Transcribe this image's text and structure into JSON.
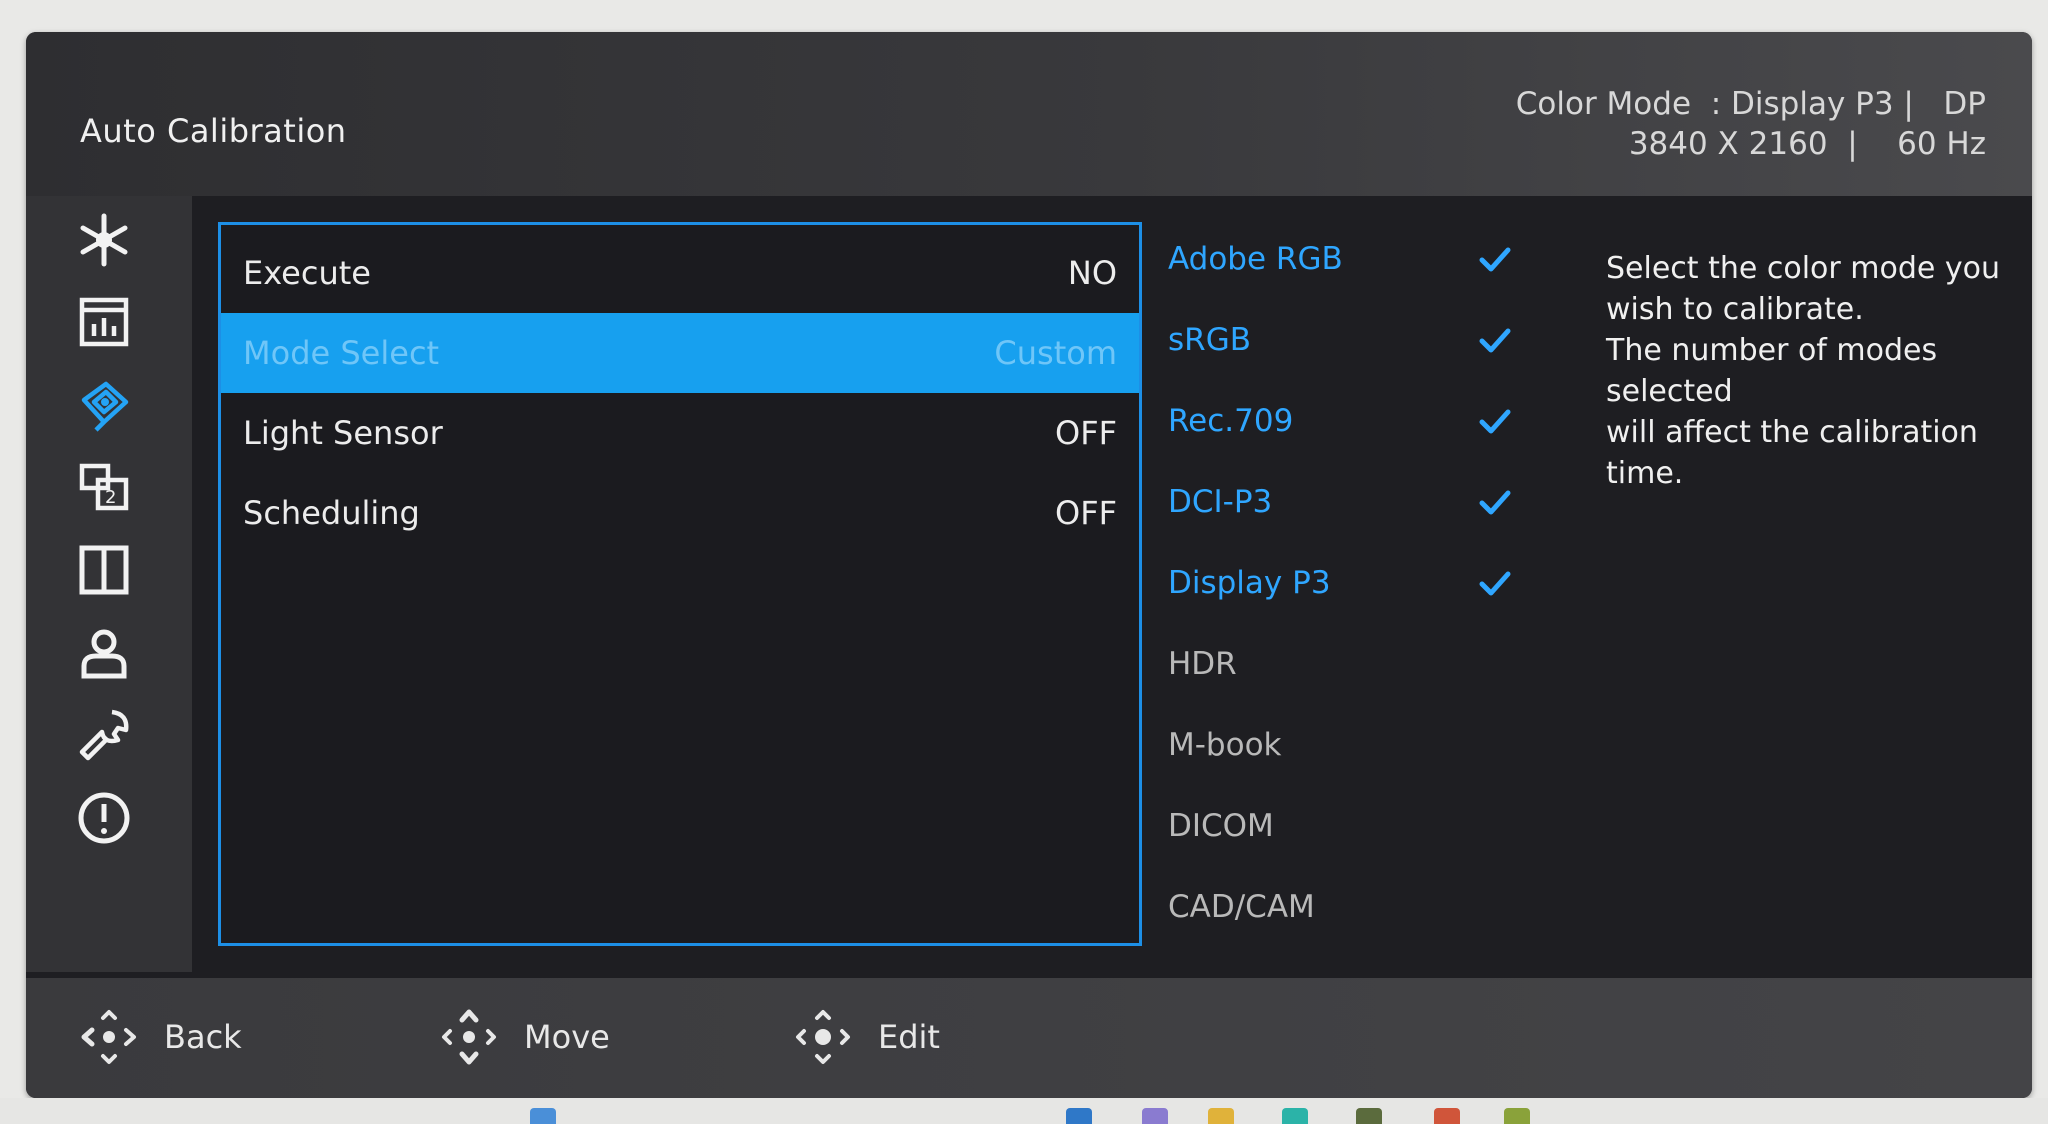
{
  "header": {
    "title": "Auto Calibration",
    "status_line1": "Color Mode  : Display P3 |   DP",
    "status_line2": "3840 X 2160  |    60 Hz"
  },
  "sidebar": {
    "icons": [
      "brightness-icon",
      "picture-adjust-icon",
      "color-calibration-icon",
      "pip-icon",
      "split-screen-icon",
      "user-icon",
      "tools-icon",
      "info-icon"
    ],
    "active_index": 2
  },
  "menu": {
    "rows": [
      {
        "label": "Execute",
        "value": "NO"
      },
      {
        "label": "Mode Select",
        "value": "Custom"
      },
      {
        "label": "Light Sensor",
        "value": "OFF"
      },
      {
        "label": "Scheduling",
        "value": "OFF"
      }
    ],
    "selected_index": 1
  },
  "options": [
    {
      "label": "Adobe RGB",
      "checked": true
    },
    {
      "label": "sRGB",
      "checked": true
    },
    {
      "label": "Rec.709",
      "checked": true
    },
    {
      "label": "DCI-P3",
      "checked": true
    },
    {
      "label": "Display P3",
      "checked": true
    },
    {
      "label": "HDR",
      "checked": false
    },
    {
      "label": "M-book",
      "checked": false
    },
    {
      "label": "DICOM",
      "checked": false
    },
    {
      "label": "CAD/CAM",
      "checked": false
    }
  ],
  "help": {
    "lines": [
      "Select the color mode you",
      "wish to calibrate.",
      "The number of modes selected",
      "will affect the calibration time."
    ]
  },
  "footer": {
    "back_label": "Back",
    "move_label": "Move",
    "edit_label": "Edit"
  },
  "colors": {
    "accent": "#1d8fe6",
    "selected_row": "#17a0ef",
    "option_on": "#2fa6ff"
  }
}
